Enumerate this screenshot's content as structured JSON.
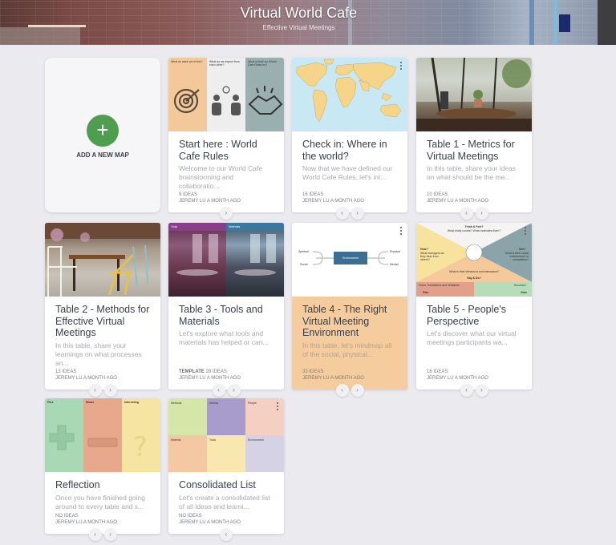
{
  "header": {
    "title": "Virtual World Cafe",
    "subtitle": "Effective Virtual Meetings"
  },
  "add_card": {
    "label": "ADD A NEW MAP",
    "icon": "plus-icon",
    "accent": "#4f9d4e"
  },
  "maps": [
    {
      "title": "Start here : World Cafe Rules",
      "description": "Welcome to our World Cafe brainstorming and collaboratio...",
      "badge": "",
      "ideas": "9 IDEAS",
      "author": "JEREMY LU A MONTH AGO",
      "thumbnail_columns": [
        "What do want out of this?",
        "What do we expect from each other?",
        "What should our World Cafe Rules be?"
      ],
      "nav": [
        "next"
      ]
    },
    {
      "title": "Check in: Where in the world?",
      "description": "Now that we have defined our World Cafe Rules, let's int...",
      "badge": "",
      "ideas": "16 IDEAS",
      "author": "JEREMY LU A MONTH AGO",
      "nav": [
        "prev",
        "next"
      ]
    },
    {
      "title": "Table 1 - Metrics for Virtual Meetings",
      "description": "In this table, share your ideas on what should be the me...",
      "badge": "",
      "ideas": "10 IDEAS",
      "author": "JEREMY LU A MONTH AGO",
      "nav": [
        "prev",
        "next"
      ]
    },
    {
      "title": "Table 2 - Methods for Effective Virtual Meetings",
      "description": "In this table, share your learnings on what processes an...",
      "badge": "",
      "ideas": "13 IDEAS",
      "author": "JEREMY LU A MONTH AGO",
      "nav": [
        "prev",
        "next"
      ]
    },
    {
      "title": "Table 3 - Tools and Materials",
      "description": "Let's explore what tools and materials has helped or can...",
      "badge": "TEMPLATE",
      "ideas": "28 IDEAS",
      "author": "JEREMY LU A MONTH AGO",
      "thumbnail_columns": [
        "Tools",
        "Materials"
      ],
      "nav": [
        "prev",
        "next"
      ]
    },
    {
      "title": "Table 4 - The Right Virtual Meeting Environment",
      "description": "In this table, let's mindmap all of the social, physical...",
      "badge": "",
      "ideas": "33 IDEAS",
      "author": "JEREMY LU A MONTH AGO",
      "thumbnail_nodes": [
        "Environment",
        "Spiritual",
        "Social",
        "Physical",
        "Mental"
      ],
      "highlight_color": "#f4cc9e",
      "nav": [
        "prev",
        "next"
      ]
    },
    {
      "title": "Table 5 - People's Perspective",
      "description": "Let's discover what our virtual meetings participants wa...",
      "badge": "",
      "ideas": "18 IDEAS",
      "author": "JEREMY LU A MONTH AGO",
      "thumbnail_labels": [
        "Think & Feel?",
        "What really counts? What motivates them?",
        "Hear?",
        "What managers do they hear from others?",
        "See?",
        "What is their social environment or competitors?",
        "What is their behaviour and interaction?",
        "Say & Do?",
        "Fears, frustrations and obstacles",
        "Pain",
        "Success?",
        "Gain"
      ],
      "nav": [
        "prev",
        "next"
      ]
    },
    {
      "title": "Reflection",
      "description": "Once you have finished going around to every table and s...",
      "badge": "",
      "ideas": "NO IDEAS",
      "author": "JEREMY LU A MONTH AGO",
      "thumbnail_columns": [
        "Plus",
        "Minus",
        "Interesting"
      ],
      "nav": [
        "prev",
        "next"
      ]
    },
    {
      "title": "Consolidated List",
      "description": "Let's create a consolidated list of all ideas and learni...",
      "badge": "",
      "ideas": "NO IDEAS",
      "author": "JEREMY LU A MONTH AGO",
      "thumbnail_columns": [
        "Methods",
        "Metrics",
        "People",
        "Material",
        "Tools",
        "Environment"
      ],
      "nav": [
        "prev"
      ]
    }
  ],
  "nav_glyphs": {
    "prev": "‹",
    "next": "›"
  }
}
